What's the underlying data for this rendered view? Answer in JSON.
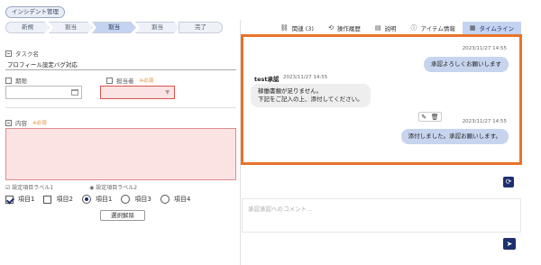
{
  "header": {
    "app_tag": "インシデント管理"
  },
  "steps": [
    {
      "label": "新規",
      "active": false
    },
    {
      "label": "割当",
      "active": false
    },
    {
      "label": "割当",
      "active": true
    },
    {
      "label": "割当",
      "active": false
    },
    {
      "label": "完了",
      "active": false
    }
  ],
  "form": {
    "task_label": "タスク名",
    "task_value": "プロフィール設定バグ対応",
    "deadline_label": "期限",
    "owner_label": "担当者",
    "owner_required": "※必須",
    "content_label": "内容",
    "content_required": "※必須",
    "checkbox_group_label": "設定項目ラベル1",
    "radio_group_label": "設定項目ラベル2",
    "checkboxes": [
      {
        "label": "項目1",
        "checked": true
      },
      {
        "label": "項目2",
        "checked": false
      }
    ],
    "radios": [
      {
        "label": "項目1",
        "selected": true
      },
      {
        "label": "項目3",
        "selected": false
      },
      {
        "label": "項目4",
        "selected": false
      }
    ],
    "clear_button": "選択解除"
  },
  "tabs": [
    {
      "label": "関連 (3)",
      "icon": "link-icon",
      "active": false
    },
    {
      "label": "操作履歴",
      "icon": "history-icon",
      "active": false
    },
    {
      "label": "説明",
      "icon": "document-icon",
      "active": false
    },
    {
      "label": "アイテム情報",
      "icon": "info-icon",
      "active": false
    },
    {
      "label": "タイムライン",
      "icon": "timeline-icon",
      "active": true
    }
  ],
  "timeline": {
    "messages": [
      {
        "from": "self",
        "timestamp": "2023/11/27 14:55",
        "text": "承認よろしくお願いします"
      },
      {
        "from": "other",
        "sender": "test承認",
        "timestamp": "2023/11/27 14:55",
        "lines": [
          "稼働書類が足りません。",
          "下記をご記入の上、添付してください。"
        ]
      },
      {
        "from": "self",
        "timestamp": "2023/11/27 14:55",
        "text": "添付しました。承認お願いします。"
      }
    ]
  },
  "comment": {
    "placeholder": "承認承認へのコメント..."
  },
  "colors": {
    "accent": "#1d2f6e",
    "highlight_border": "#e8732a",
    "error_bg": "#fbe3e3",
    "tab_active": "#c4d3ef"
  }
}
